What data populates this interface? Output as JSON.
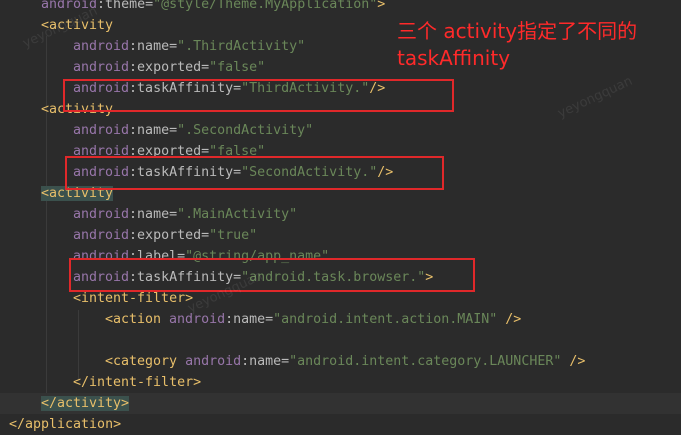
{
  "note_text": "三个 activity指定了不同的taskAffinity",
  "watermark": "yeyongquan",
  "code": {
    "l0": {
      "ns": "android",
      "attr": ":theme=",
      "val": "\"@style/Theme.MyApplication\"",
      "end": ">"
    },
    "l1": {
      "tag": "<activity"
    },
    "l2": {
      "ns": "android",
      "attr": ":name=",
      "val": "\".ThirdActivity\""
    },
    "l3": {
      "ns": "android",
      "attr": ":exported=",
      "val": "\"false\""
    },
    "l4": {
      "ns": "android",
      "attr": ":taskAffinity=",
      "val": "\"ThirdActivity.\"",
      "end": "/>"
    },
    "l5": {
      "tag": "<activity"
    },
    "l6": {
      "ns": "android",
      "attr": ":name=",
      "val": "\".SecondActivity\""
    },
    "l7": {
      "ns": "android",
      "attr": ":exported=",
      "val": "\"false\""
    },
    "l8": {
      "ns": "android",
      "attr": ":taskAffinity=",
      "val": "\"SecondActivity.\"",
      "end": "/>"
    },
    "l9": {
      "tag": "<activity"
    },
    "l10": {
      "ns": "android",
      "attr": ":name=",
      "val": "\".MainActivity\""
    },
    "l11": {
      "ns": "android",
      "attr": ":exported=",
      "val": "\"true\""
    },
    "l12": {
      "ns": "android",
      "attr": ":label=",
      "val": "\"@string/app_name\""
    },
    "l13": {
      "ns": "android",
      "attr": ":taskAffinity=",
      "val": "\"android.task.browser.\"",
      "end": ">"
    },
    "l14": {
      "tag": "<intent-filter>"
    },
    "l15": {
      "tag": "<action ",
      "ns": "android",
      "attr": ":name=",
      "val": "\"android.intent.action.MAIN\"",
      "end": " />"
    },
    "l17": {
      "tag": "<category ",
      "ns": "android",
      "attr": ":name=",
      "val": "\"android.intent.category.LAUNCHER\"",
      "end": " />"
    },
    "l18": {
      "tag": "</intent-filter>"
    },
    "l19": {
      "tag": "</activity>"
    },
    "l20": {
      "tag": "</application>"
    }
  }
}
